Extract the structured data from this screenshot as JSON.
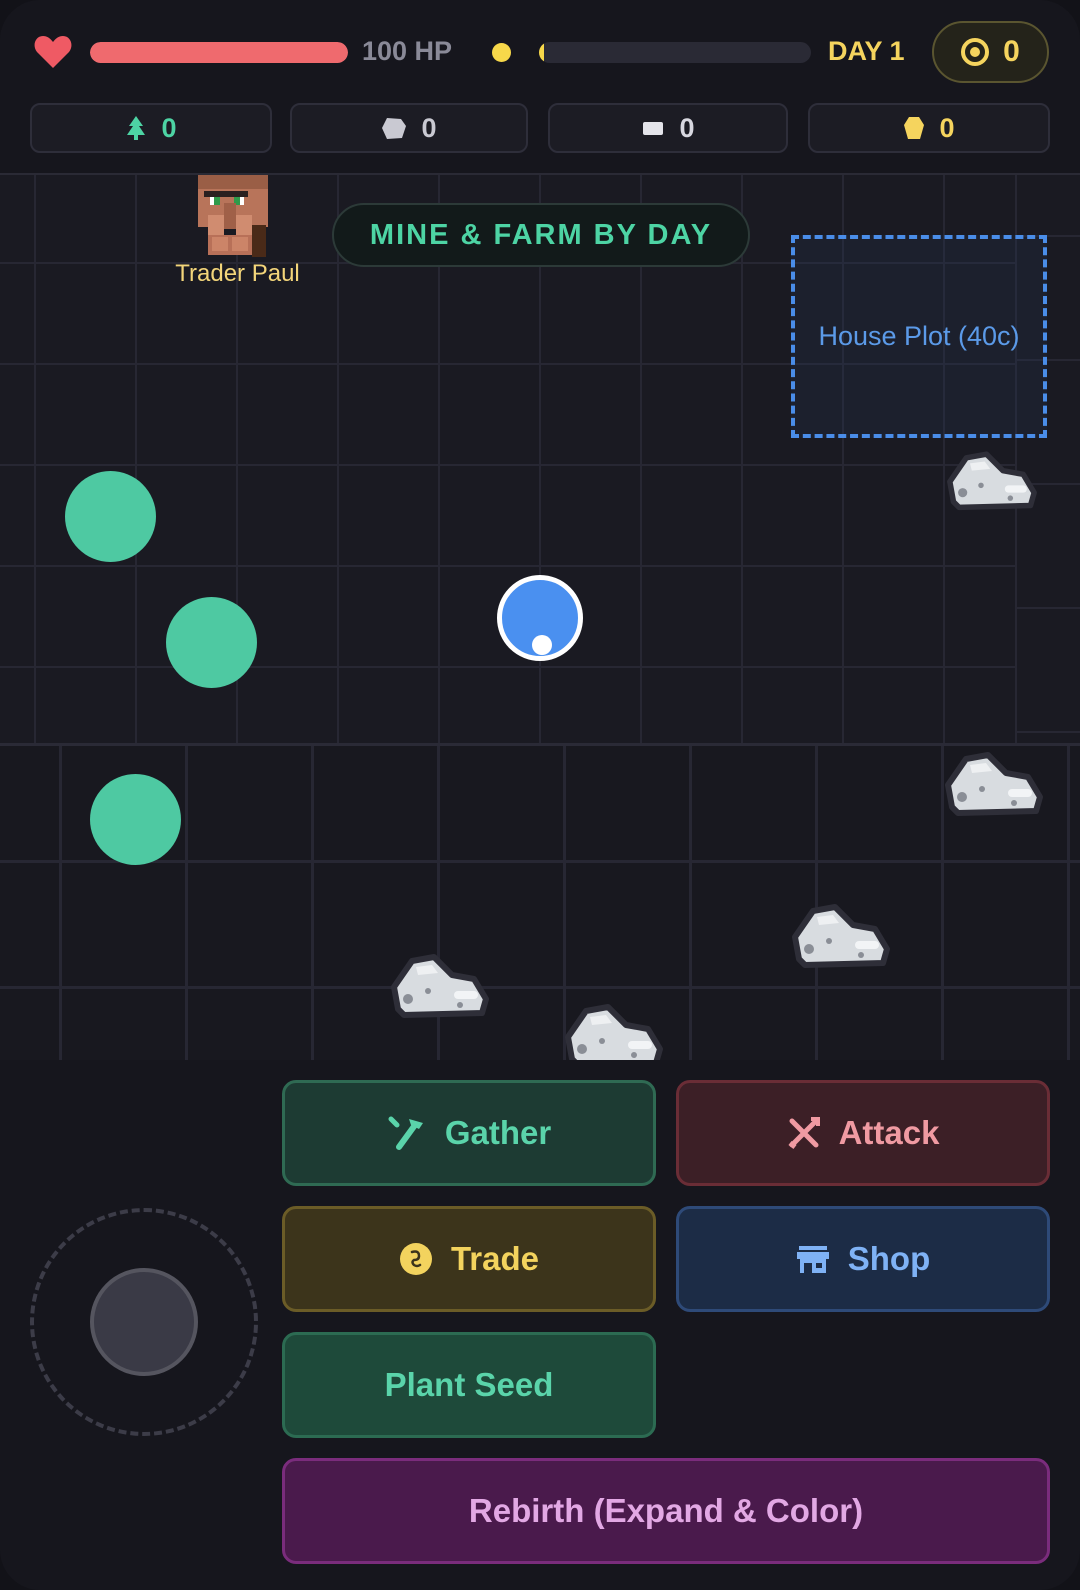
{
  "hud": {
    "health": {
      "label": "100 HP",
      "fill_percent": 100,
      "color": "#ef6a6e"
    },
    "day": {
      "label": "DAY 1",
      "progress_percent": 2,
      "color": "#f7d84a"
    },
    "coins": {
      "value": "0",
      "color": "#f5d45e"
    },
    "resources": [
      {
        "icon": "tree-icon",
        "value": "0",
        "color": "#4dd4a4"
      },
      {
        "icon": "stone-icon",
        "value": "0",
        "color": "#c9c9d2"
      },
      {
        "icon": "iron-icon",
        "value": "0",
        "color": "#d8d8e0"
      },
      {
        "icon": "gold-icon",
        "value": "0",
        "color": "#f5d45e"
      }
    ]
  },
  "world": {
    "banner": "MINE & FARM BY DAY",
    "trader": {
      "name": "Trader Paul"
    },
    "house_plot": {
      "label": "House Plot (40c)"
    }
  },
  "actions": {
    "gather": "Gather",
    "attack": "Attack",
    "trade": "Trade",
    "shop": "Shop",
    "plant_seed": "Plant Seed",
    "rebirth": "Rebirth (Expand & Color)"
  }
}
